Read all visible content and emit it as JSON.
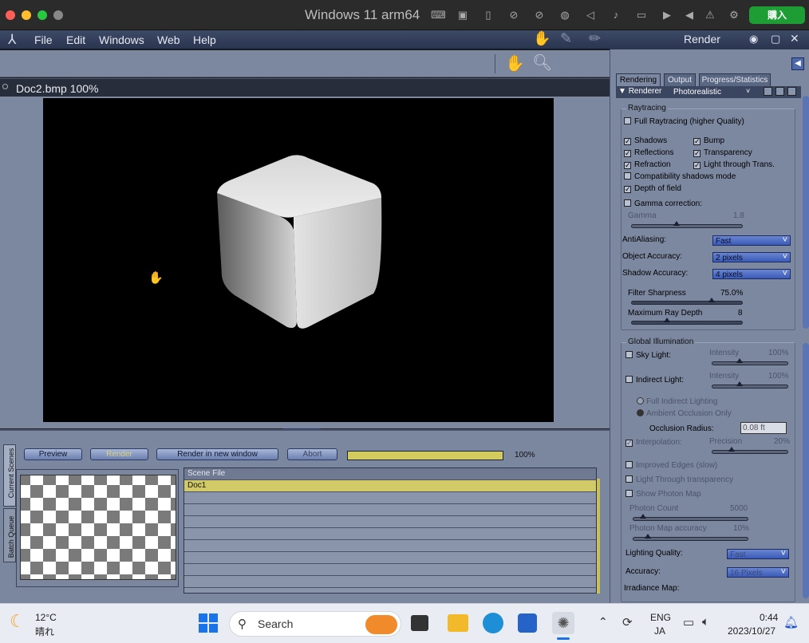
{
  "host": {
    "title": "Windows 11 arm64",
    "buy_label": "購入"
  },
  "menubar": {
    "items": [
      "File",
      "Edit",
      "Windows",
      "Web",
      "Help"
    ]
  },
  "document": {
    "tab_title": "Doc2.bmp 100%"
  },
  "render_panel": {
    "title": "Render",
    "tabs": [
      "Rendering",
      "Output",
      "Progress/Statistics"
    ],
    "renderer_label": "Renderer",
    "renderer_value": "Photorealistic",
    "raytracing": {
      "title": "Raytracing",
      "full": "Full Raytracing (higher Quality)",
      "shadows": "Shadows",
      "bump": "Bump",
      "reflections": "Reflections",
      "transparency": "Transparency",
      "refraction": "Refraction",
      "light_through": "Light through Trans.",
      "compat": "Compatibility shadows mode",
      "dof": "Depth of field",
      "gamma_corr": "Gamma correction:",
      "gamma_label": "Gamma",
      "gamma_value": "1.8",
      "antialiasing_label": "AntiAliasing:",
      "antialiasing_value": "Fast",
      "object_acc_label": "Object Accuracy:",
      "object_acc_value": "2 pixels",
      "shadow_acc_label": "Shadow Accuracy:",
      "shadow_acc_value": "4 pixels",
      "filter_label": "Filter Sharpness",
      "filter_value": "75.0%",
      "raydepth_label": "Maximum Ray Depth",
      "raydepth_value": "8"
    },
    "gi": {
      "title": "Global Illumination",
      "sky": "Sky Light:",
      "intensity": "Intensity",
      "sky_int": "100%",
      "indirect": "Indirect Light:",
      "ind_int": "100%",
      "full_indirect": "Full Indirect Lighting",
      "ambient": "Ambient Occlusion Only",
      "occ_label": "Occlusion Radius:",
      "occ_value": "0.08 ft",
      "interp": "Interpolation:",
      "precision": "Precision",
      "precision_val": "20%",
      "improved": "Improved Edges (slow)",
      "ltt": "Light Through transparency",
      "photon_map": "Show Photon Map",
      "photon_count": "Photon Count",
      "photon_count_val": "5000",
      "photon_acc": "Photon Map accuracy",
      "photon_acc_val": "10%",
      "lq_label": "Lighting Quality:",
      "lq_value": "Fast",
      "acc_label": "Accuracy:",
      "acc_value": "16 Pixels",
      "irr_label": "Irradiance Map:"
    }
  },
  "bottom": {
    "preview": "Preview",
    "render": "Render",
    "render_new": "Render in new window",
    "abort": "Abort",
    "progress_pct": "100%",
    "progress_fraction": 1.0,
    "tab_current": "Current Scenes",
    "tab_batch": "Batch Queue",
    "scene_header": "Scene File",
    "scenes": [
      "Doc1"
    ]
  },
  "taskbar": {
    "temp": "12°C",
    "weather": "晴れ",
    "search": "Search",
    "lang1": "ENG",
    "lang2": "JA",
    "time": "0:44",
    "date": "2023/10/27"
  },
  "colors": {
    "accent_yellow": "#d4cb5e",
    "panel": "#7c88a0",
    "taskbar": "#e9ecf2"
  }
}
